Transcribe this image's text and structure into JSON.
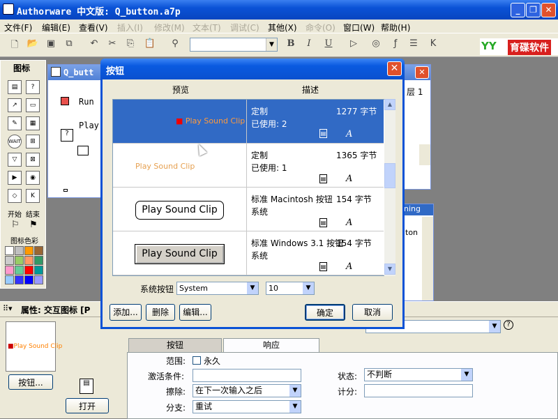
{
  "app": {
    "title": "Authorware 中文版: Q_button.a7p",
    "window_buttons": [
      "_",
      "❐",
      "✕"
    ]
  },
  "menu": [
    "文件(F)",
    "编辑(E)",
    "查看(V)",
    "插入(I)",
    "修改(M)",
    "文本(T)",
    "调试(C)",
    "其他(X)",
    "命令(O)",
    "窗口(W)",
    "帮助(H)"
  ],
  "toolbar": {
    "bold": "B",
    "italic": "I",
    "underline": "U",
    "logo_text": "育碟软件",
    "logo_mark": "YY"
  },
  "palette": {
    "title": "图标",
    "start_label": "开始",
    "end_label": "结束",
    "color_label": "图标色彩",
    "colors": [
      "#ffffff",
      "#c0c0c0",
      "#ff9900",
      "#996633",
      "#cccccc",
      "#99cc66",
      "#ff9966",
      "#339966",
      "#ff99cc",
      "#66cc99",
      "#ff0000",
      "#009999",
      "#99ccff",
      "#3333ff",
      "#0000ff",
      "#9999ff"
    ]
  },
  "flowline": {
    "window_title": "Q_butt",
    "item_run": "Run",
    "item_play": "Play"
  },
  "right_panel": {
    "layer_label": "层 1",
    "item_ing": "ning",
    "item_on": "ton"
  },
  "dialog": {
    "title": "按钮",
    "col_preview": "预览",
    "col_desc": "描述",
    "rows": [
      {
        "preview_text": "Play Sound Clip",
        "kind": "定制",
        "used": "已使用: 2",
        "size": "1277 字节"
      },
      {
        "preview_text": "Play Sound Clip",
        "kind": "定制",
        "used": "已使用: 1",
        "size": "1365 字节"
      },
      {
        "preview_text": "Play Sound Clip",
        "kind": "标准 Macintosh 按钮",
        "used": "系统",
        "size": "154 字节"
      },
      {
        "preview_text": "Play Sound Clip",
        "kind": "标准 Windows 3.1 按钮",
        "used": "系统",
        "size": "154 字节"
      }
    ],
    "system_button_label": "系统按钮",
    "font_value": "System",
    "size_value": "10",
    "add_button": "添加...",
    "delete_button": "删除",
    "edit_button": "编辑...",
    "ok_button": "确定",
    "cancel_button": "取消"
  },
  "properties": {
    "header": "属性: 交互图标 [P",
    "preview_text": "Play Sound Clip",
    "button_button": "按钮...",
    "open_button": "打开",
    "tab_button": "按钮",
    "tab_response": "响应",
    "scope_label": "范围:",
    "scope_value": "永久",
    "activate_label": "激活条件:",
    "activate_value": "",
    "erase_label": "擦除:",
    "erase_value": "在下一次输入之后",
    "branch_label": "分支:",
    "branch_value": "重试",
    "status_label": "状态:",
    "status_value": "不判断",
    "score_label": "计分:",
    "score_value": ""
  }
}
